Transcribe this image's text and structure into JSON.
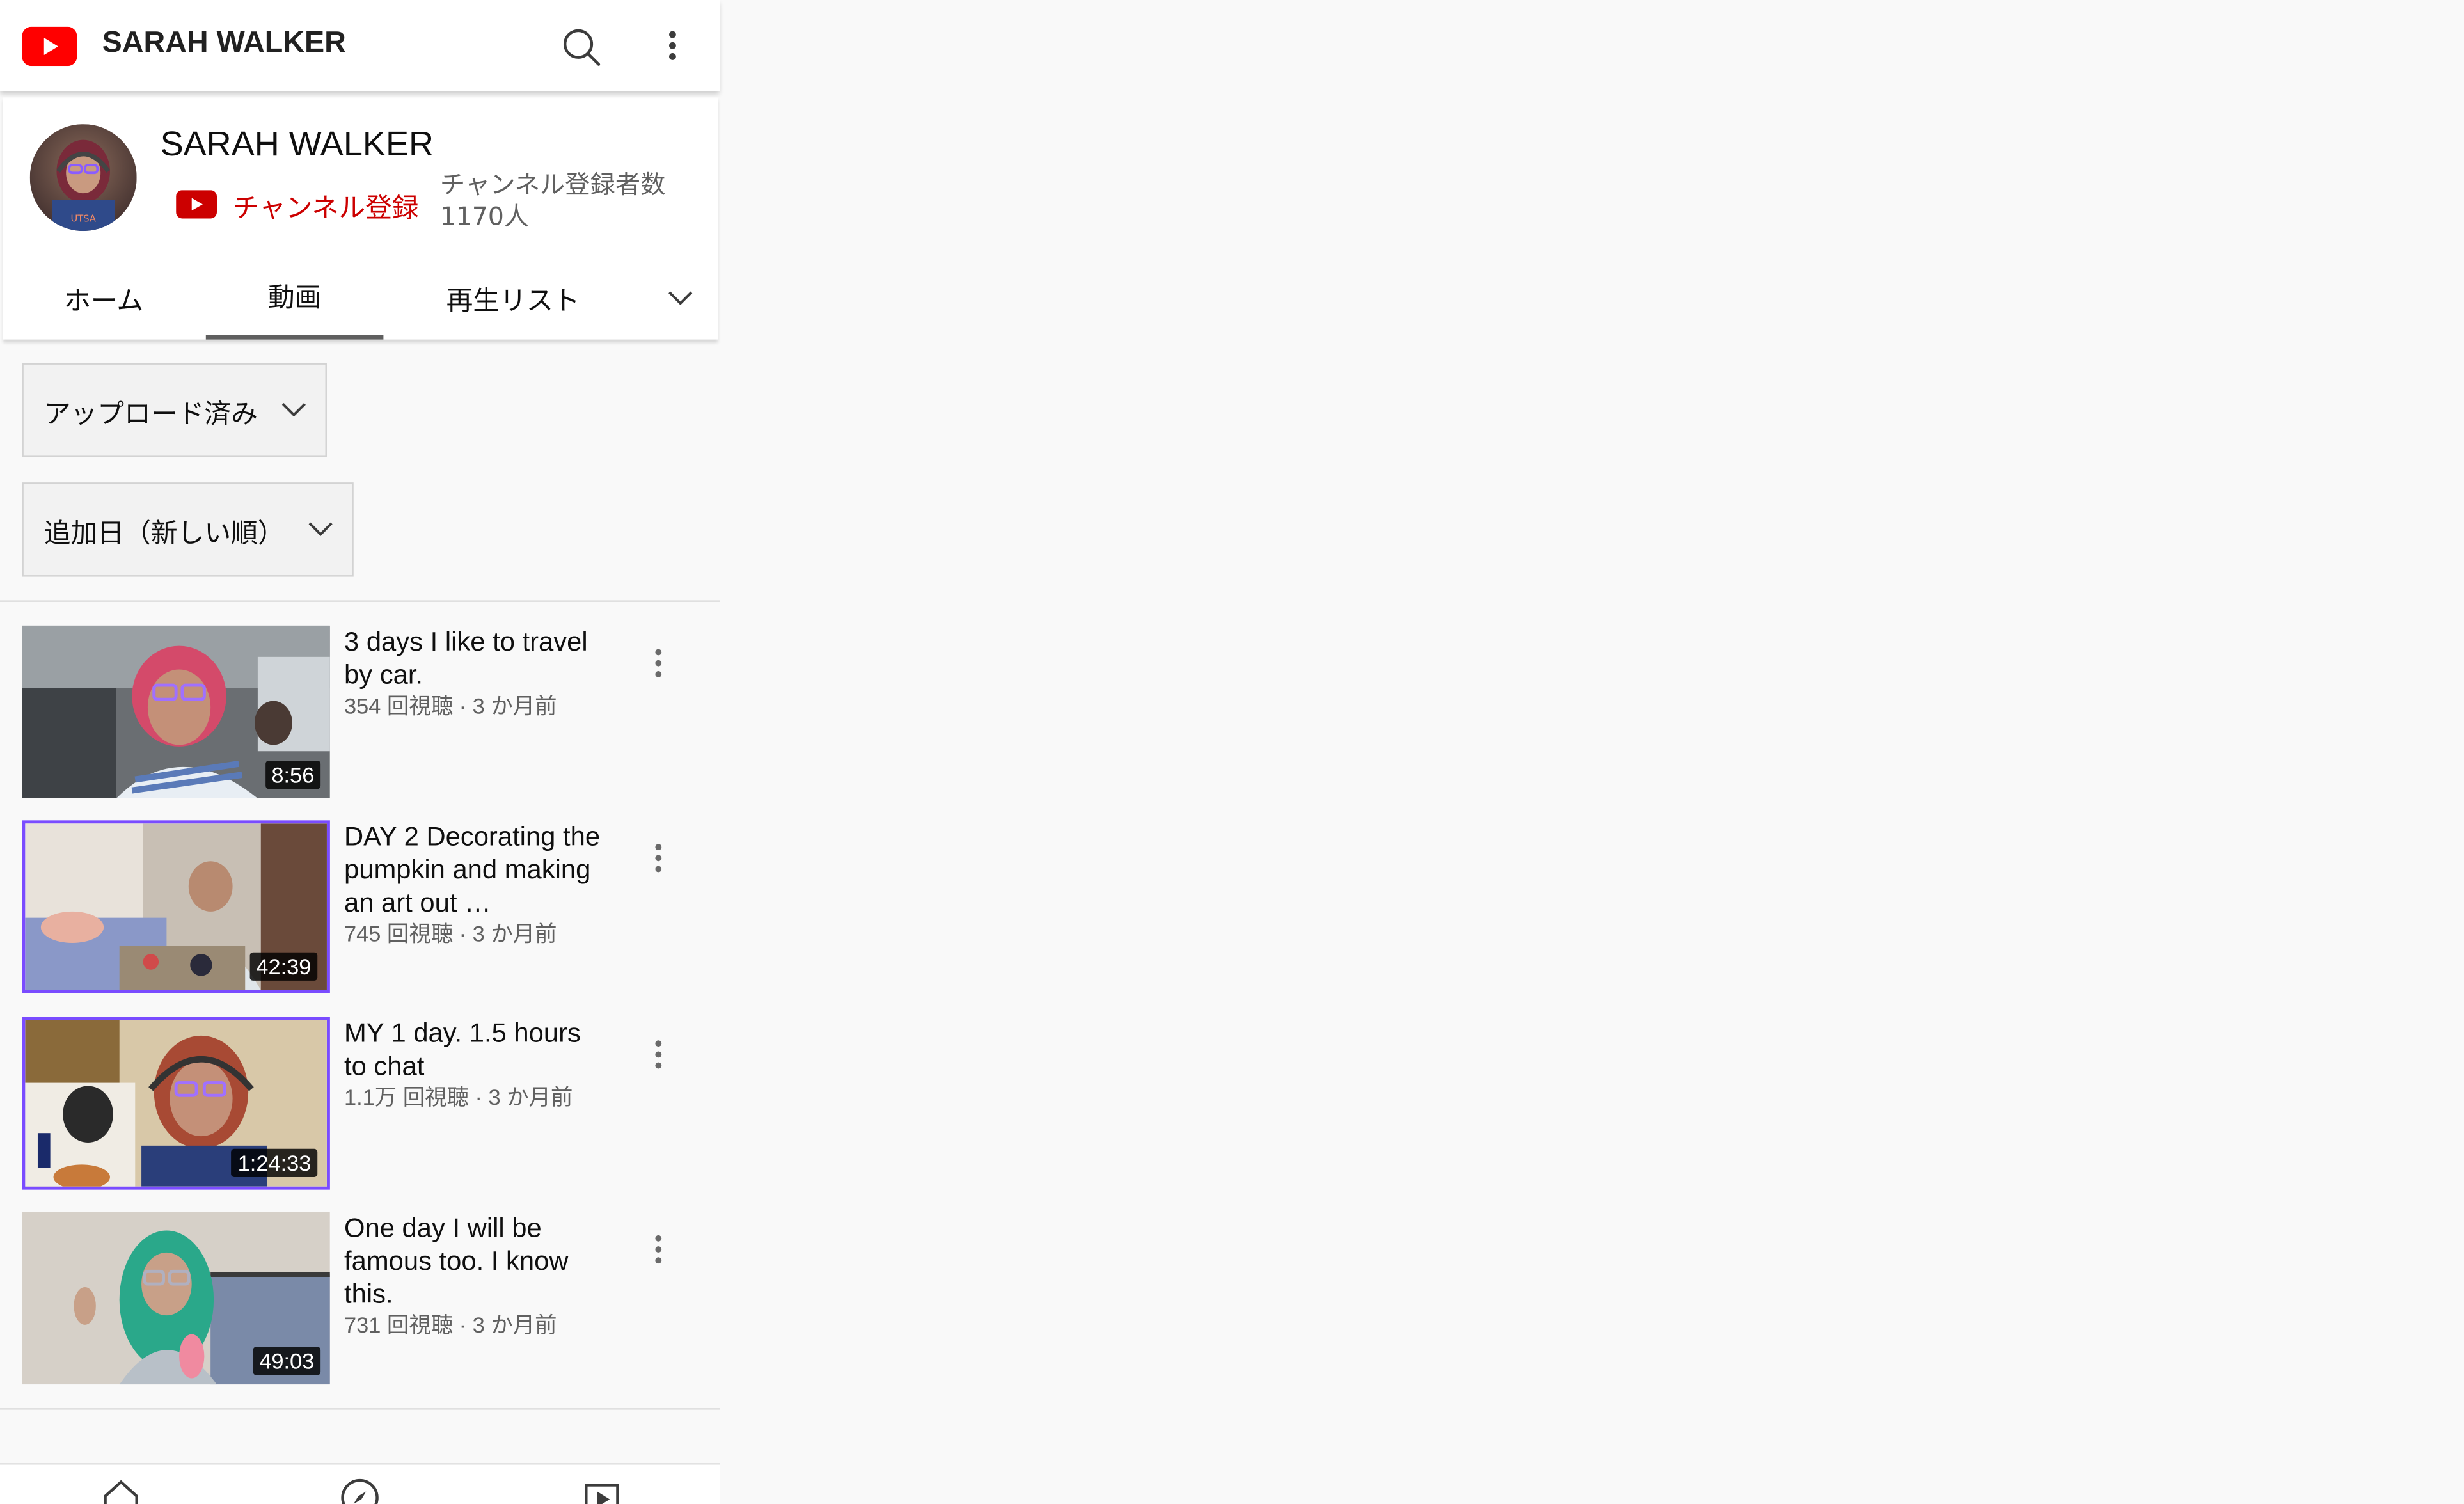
{
  "app_bar": {
    "title": "SARAH WALKER",
    "icons": [
      "youtube-logo-icon",
      "search-icon",
      "more-vert-icon"
    ]
  },
  "channel": {
    "name": "SARAH WALKER",
    "subscribe_label": "チャンネル登録",
    "subscriber_count": "チャンネル登録者数 1170人"
  },
  "tabs": [
    {
      "label": "ホーム",
      "active": false
    },
    {
      "label": "動画",
      "active": true
    },
    {
      "label": "再生リスト",
      "active": false
    }
  ],
  "filters": {
    "type_selected": "アップロード済み",
    "sort_selected": "追加日（新しい順）"
  },
  "videos": [
    {
      "title": "3 days I like to travel by car.",
      "duration": "8:56",
      "meta": "354 回視聴 · 3 か月前"
    },
    {
      "title": "DAY 2 Decorating the pumpkin and making an art out …",
      "duration": "42:39",
      "meta": "745 回視聴 · 3 か月前"
    },
    {
      "title": "MY 1 day. 1.5 hours to chat",
      "duration": "1:24:33",
      "meta": "1.1万 回視聴 · 3 か月前"
    },
    {
      "title": "One day I will be famous too. I know this.",
      "duration": "49:03",
      "meta": "731 回視聴 · 3 か月前"
    }
  ],
  "bottom_nav": [
    "home-icon",
    "explore-icon",
    "subscriptions-icon"
  ],
  "colors": {
    "brand_red": "#ff0000",
    "subscribe_red": "#cc0000",
    "background": "#f9f9f9",
    "meta_gray": "#606060"
  }
}
